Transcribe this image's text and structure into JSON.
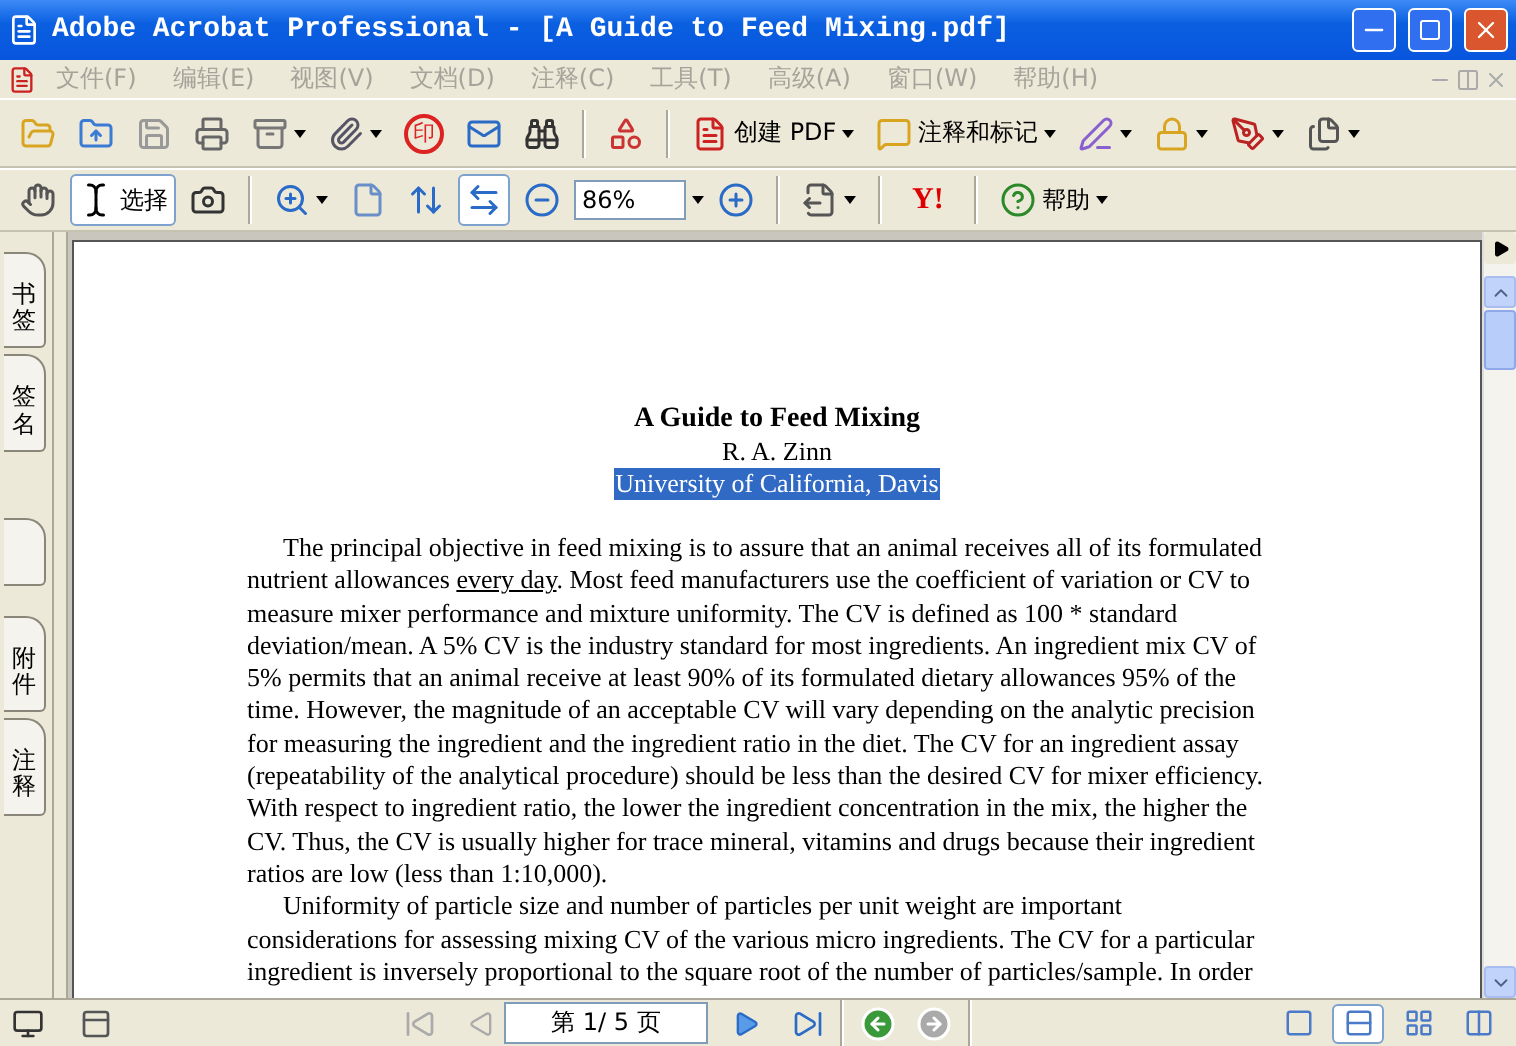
{
  "window": {
    "title": "Adobe Acrobat Professional - [A Guide to Feed Mixing.pdf]"
  },
  "menu": [
    "文件(F)",
    "编辑(E)",
    "视图(V)",
    "文档(D)",
    "注释(C)",
    "工具(T)",
    "高级(A)",
    "窗口(W)",
    "帮助(H)"
  ],
  "toolbar_1": {
    "stamp": "印",
    "create_pdf": "创建 PDF",
    "comment_markup": "注释和标记"
  },
  "toolbar_2": {
    "select_tool": {
      "label": "选择",
      "selected": true
    },
    "fit_width": {
      "selected": true
    },
    "zoom": "86%",
    "yahoo": "Y!",
    "help": "帮助"
  },
  "sidebar_tabs": [
    {
      "kind": "label",
      "label": "书签"
    },
    {
      "kind": "label",
      "label": "签名"
    },
    {
      "kind": "blank"
    },
    {
      "kind": "label",
      "label": "附件"
    },
    {
      "kind": "label",
      "label": "注释"
    }
  ],
  "document": {
    "title": "A Guide to Feed Mixing",
    "author": "R. A. Zinn",
    "affiliation": {
      "text": "University of California, Davis",
      "highlighted": true
    },
    "paragraphs": [
      {
        "lines": [
          [
            {
              "text": "The principal objective in feed mixing is to assure that an animal receives all of its formulated"
            }
          ],
          [
            {
              "text": "nutrient allowances "
            },
            {
              "text": "every day",
              "underline": true
            },
            {
              "text": ". Most feed manufacturers use the coefficient of variation or CV to"
            }
          ],
          [
            {
              "text": "measure mixer performance and mixture uniformity. The CV is defined as 100 * standard"
            }
          ],
          [
            {
              "text": "deviation/mean. A 5% CV is the industry standard for most ingredients. An ingredient mix CV of"
            }
          ],
          [
            {
              "text": "5% permits that an animal receive at least 90% of its formulated dietary allowances 95% of the"
            }
          ],
          [
            {
              "text": "time. However, the magnitude of an acceptable CV will vary depending on the analytic precision"
            }
          ],
          [
            {
              "text": "for measuring the ingredient and the ingredient ratio in the diet. The CV for an ingredient assay"
            }
          ],
          [
            {
              "text": "(repeatability of the analytical procedure) should be less than the desired CV for mixer efficiency."
            }
          ],
          [
            {
              "text": "With respect to ingredient ratio, the lower the ingredient concentration in the mix, the higher the"
            }
          ],
          [
            {
              "text": "CV. Thus, the CV is usually higher for trace mineral, vitamins and drugs because their ingredient"
            }
          ],
          [
            {
              "text": "ratios are low (less than 1:10,000)."
            }
          ]
        ]
      },
      {
        "lines": [
          [
            {
              "text": "Uniformity of particle size and number of particles per unit weight are important"
            }
          ],
          [
            {
              "text": "considerations for assessing mixing CV of the various micro ingredients. The CV for a particular"
            }
          ],
          [
            {
              "text": "ingredient is inversely proportional to the square root of the number of particles/sample. In order"
            }
          ]
        ]
      }
    ]
  },
  "status_bar": {
    "page": "第 1/ 5 页",
    "view_modes": [
      {
        "selected": false
      },
      {
        "selected": true
      },
      {
        "selected": false
      },
      {
        "selected": false
      }
    ]
  }
}
